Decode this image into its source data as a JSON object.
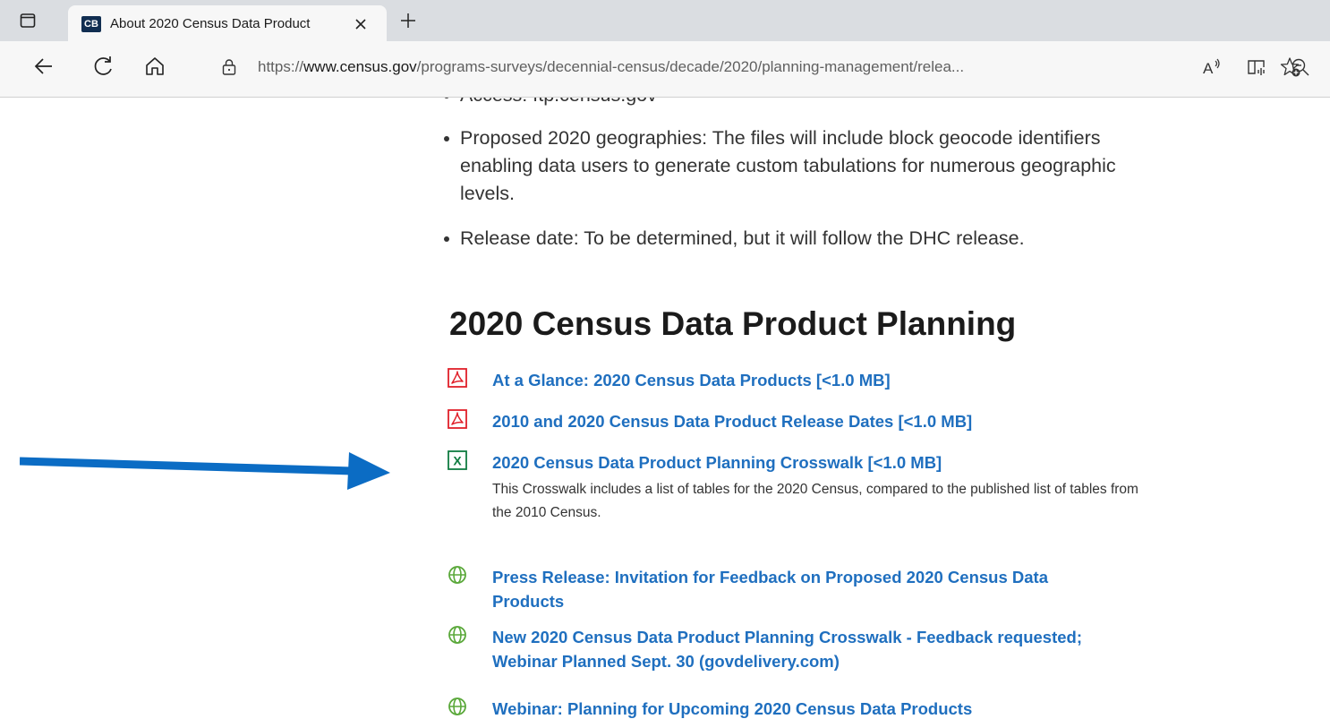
{
  "browser": {
    "tab": {
      "favicon_text": "CB",
      "title": "About 2020 Census Data Product"
    },
    "address_bar": {
      "url_prefix": "https://",
      "url_host": "www.census.gov",
      "url_path": "/programs-surveys/decennial-census/decade/2020/planning-management/relea..."
    },
    "icons": [
      "tab-actions-icon",
      "close-icon",
      "new-tab-icon",
      "back-icon",
      "refresh-icon",
      "home-icon",
      "lock-icon",
      "read-aloud-icon",
      "immersive-reader-icon",
      "zoom-icon",
      "add-favorite-icon"
    ]
  },
  "page": {
    "bullets": {
      "cut_off": "Access: ftp.census.gov",
      "geographies": "Proposed 2020 geographies: The files will include block geocode identifiers enabling data users to generate custom tabulations for numerous geographic levels.",
      "release": "Release date: To be determined, but it will follow the DHC release."
    },
    "section_title": "2020 Census Data Product Planning",
    "links": [
      {
        "icon": "pdf-icon",
        "label": "At a Glance: 2020 Census Data Products [<1.0 MB]"
      },
      {
        "icon": "pdf-icon",
        "label": "2010 and 2020 Census Data Product Release Dates [<1.0 MB]"
      },
      {
        "icon": "excel-icon",
        "label": "2020 Census Data Product Planning Crosswalk [<1.0 MB]",
        "description": "This Crosswalk includes a list of tables for the 2020 Census, compared to the published list of tables from the 2010 Census."
      },
      {
        "icon": "globe-icon",
        "label": "Press Release: Invitation for Feedback on Proposed 2020 Census Data Products"
      },
      {
        "icon": "globe-icon",
        "label": "New 2020 Census Data Product Planning Crosswalk - Feedback requested; Webinar Planned Sept. 30 (govdelivery.com)"
      },
      {
        "icon": "globe-icon",
        "label": "Webinar: Planning for Upcoming 2020 Census Data Products"
      }
    ]
  },
  "colors": {
    "link": "#1f6fbf",
    "pdf": "#e0202a",
    "excel": "#107c41",
    "globe": "#5aa83a",
    "annotation_arrow": "#0b6cc4"
  }
}
